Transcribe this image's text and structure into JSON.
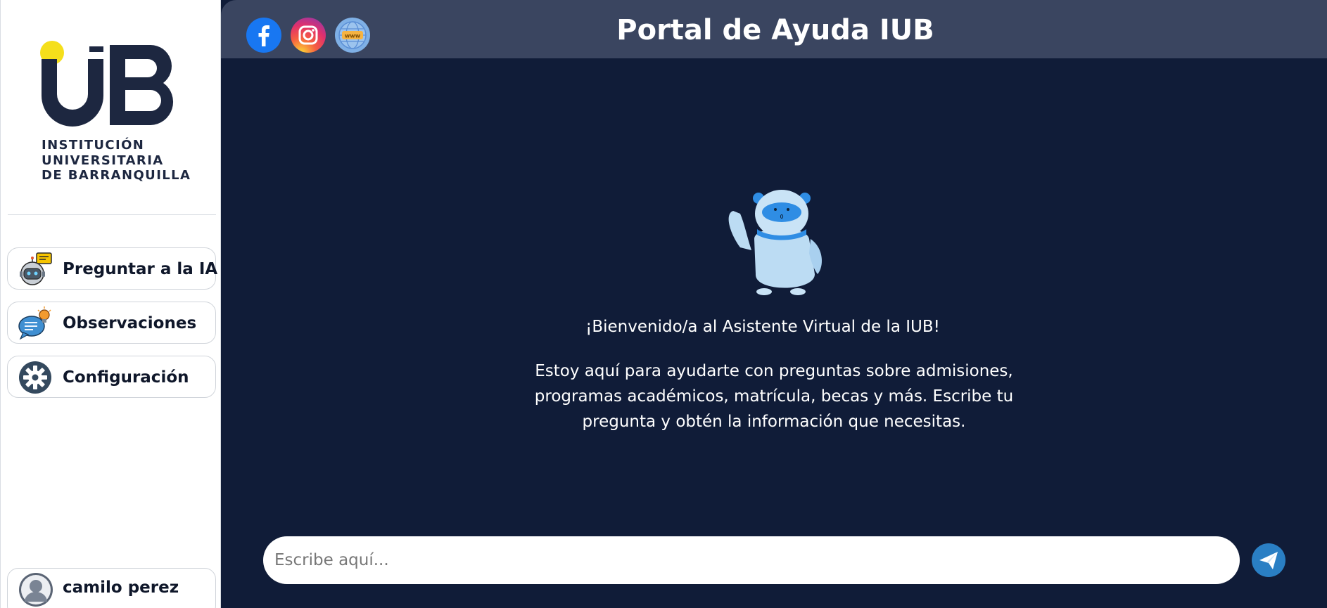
{
  "sidebar": {
    "logo": {
      "text_lines": [
        "INSTITUCIÓN",
        "UNIVERSITARIA",
        "DE BARRANQUILLA"
      ],
      "brand_colors": {
        "yellow": "#f5df1b",
        "navy": "#1d2740"
      }
    },
    "items": [
      {
        "label": "Preguntar a la IA",
        "icon": "robot-chat-icon"
      },
      {
        "label": "Observaciones",
        "icon": "chat-bulb-icon"
      },
      {
        "label": "Configuración",
        "icon": "gear-icon"
      }
    ],
    "user": {
      "name": "camilo perez",
      "icon": "user-avatar-icon"
    }
  },
  "header": {
    "title": "Portal de Ayuda IUB",
    "social": [
      {
        "name": "facebook-icon",
        "color": "#1877f2"
      },
      {
        "name": "instagram-icon",
        "color": "#e1306c"
      },
      {
        "name": "website-globe-icon",
        "color": "#5b8fd6"
      }
    ],
    "background": "#3a4560"
  },
  "main": {
    "background": "#101c38",
    "welcome": "¡Bienvenido/a al Asistente Virtual de la IUB!",
    "intro": "Estoy aquí para ayudarte con preguntas sobre admisiones, programas académicos, matrícula, becas y más. Escribe tu pregunta y obtén la información que necesitas.",
    "input": {
      "placeholder": "Escribe aquí...",
      "value": ""
    },
    "send_icon": "send-paper-plane-icon",
    "accent": "#2a7fc4"
  }
}
